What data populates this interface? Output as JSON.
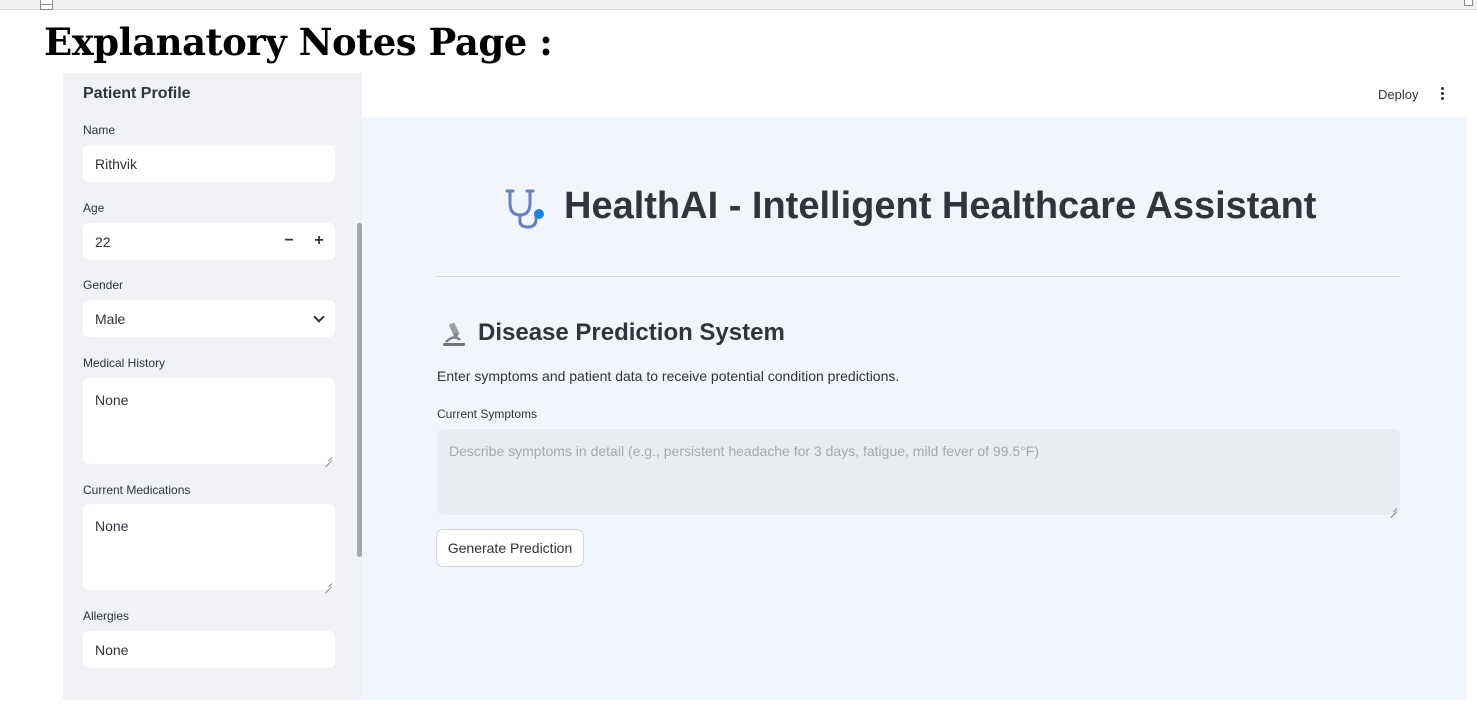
{
  "document": {
    "heading": "Explanatory Notes Page :"
  },
  "sidebar": {
    "title": "Patient Profile",
    "name": {
      "label": "Name",
      "value": "Rithvik"
    },
    "age": {
      "label": "Age",
      "value": "22",
      "decrement": "−",
      "increment": "+"
    },
    "gender": {
      "label": "Gender",
      "value": "Male"
    },
    "medical_history": {
      "label": "Medical History",
      "value": "None"
    },
    "current_medications": {
      "label": "Current Medications",
      "value": "None"
    },
    "allergies": {
      "label": "Allergies",
      "value": "None"
    }
  },
  "header": {
    "deploy_label": "Deploy",
    "menu_icon": "more-vertical-icon"
  },
  "main": {
    "title_icon": "stethoscope-icon",
    "title": "HealthAI - Intelligent Healthcare Assistant",
    "section_icon": "microscope-icon",
    "section_title": "Disease Prediction System",
    "section_description": "Enter symptoms and patient data to receive potential condition predictions.",
    "symptoms": {
      "label": "Current Symptoms",
      "placeholder": "Describe symptoms in detail (e.g., persistent headache for 3 days, fatigue, mild fever of 99.5°F)",
      "value": ""
    },
    "generate_button": "Generate Prediction"
  },
  "colors": {
    "sidebar_bg": "#f0f2f6",
    "main_bg": "#f0f6fc",
    "text": "#31333f",
    "accent_icon": "#1c83e1"
  }
}
